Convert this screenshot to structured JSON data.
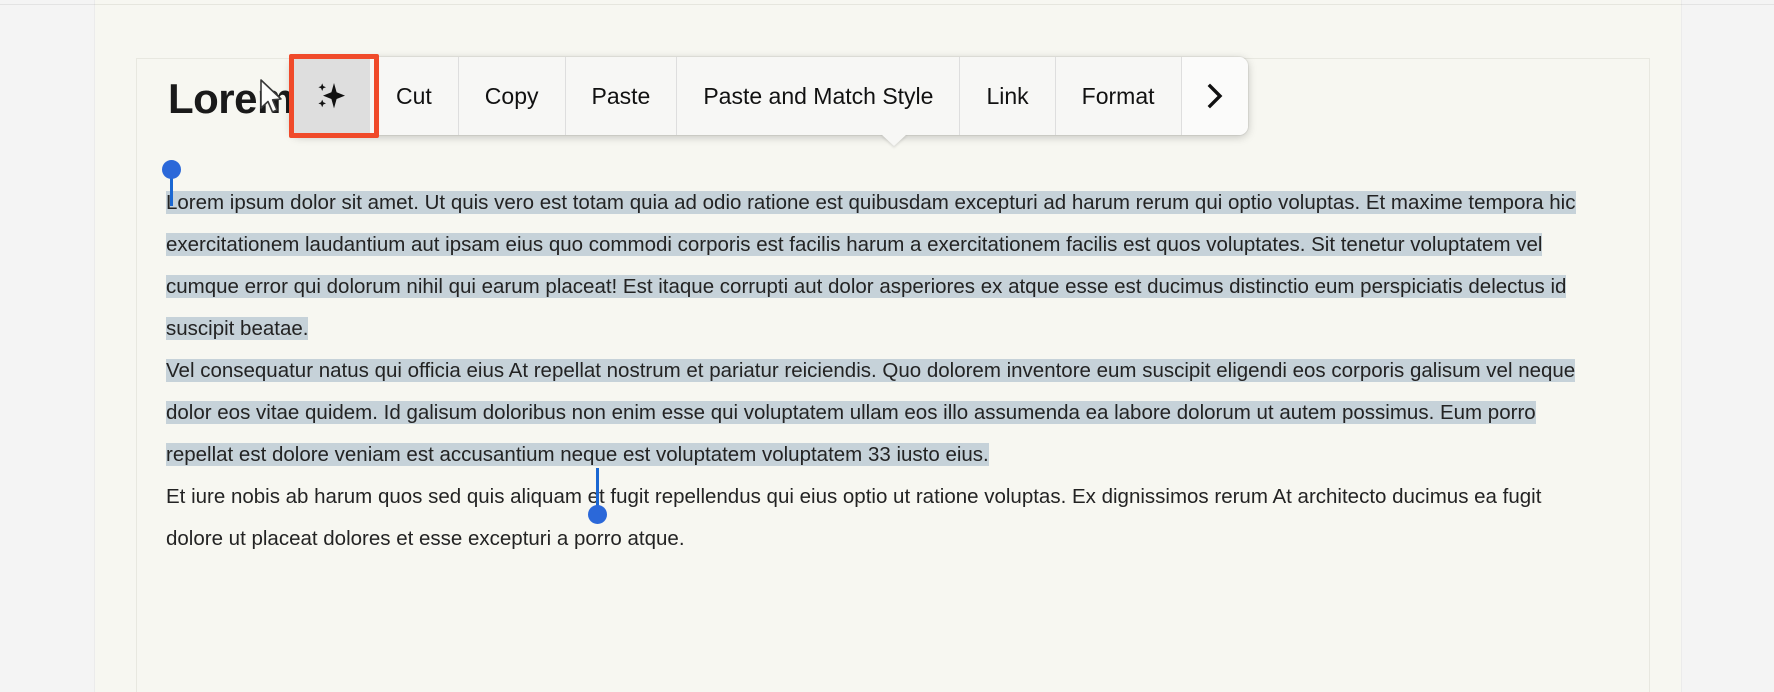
{
  "document": {
    "title": "Lorem",
    "paragraphs": [
      {
        "id": "p1",
        "selected_text": "Lorem ipsum dolor sit amet. Ut quis vero est totam quia ad odio ratione est quibusdam excepturi ad harum rerum qui optio voluptas. Et maxime tempora hic exercitationem laudantium aut ipsam eius quo commodi corporis est facilis harum a exercitationem facilis est quos voluptates. Sit tenetur voluptatem vel cumque error qui dolorum nihil qui earum placeat! Est itaque corrupti aut dolor asperiores ex atque esse est ducimus distinctio eum perspiciatis delectus id suscipit beatae."
      },
      {
        "id": "p2",
        "selected_text": "Vel consequatur natus qui officia eius At repellat nostrum et pariatur reiciendis. Quo dolorem inventore eum suscipit eligendi eos corporis galisum vel neque dolor eos vitae quidem. Id galisum doloribus non enim esse qui voluptatem ullam eos illo assumenda ea labore dolorum ut autem possimus. Eum porro repellat est dolore veniam est accusantium neque est voluptatem voluptatem 33 iusto eius."
      },
      {
        "id": "p3",
        "text": "Et iure nobis ab harum quos sed quis aliquam et fugit repellendus qui eius optio ut ratione voluptas. Ex dignissimos rerum At architecto ducimus ea fugit dolore ut placeat dolores et esse excepturi a porro atque."
      }
    ]
  },
  "context_menu": {
    "items": [
      {
        "id": "sparkle",
        "label": "",
        "icon": "sparkle-icon",
        "highlighted": true
      },
      {
        "id": "cut",
        "label": "Cut",
        "icon": ""
      },
      {
        "id": "copy",
        "label": "Copy",
        "icon": ""
      },
      {
        "id": "paste",
        "label": "Paste",
        "icon": ""
      },
      {
        "id": "paste_match_style",
        "label": "Paste and Match Style",
        "icon": ""
      },
      {
        "id": "link",
        "label": "Link",
        "icon": ""
      },
      {
        "id": "format",
        "label": "Format",
        "icon": ""
      },
      {
        "id": "more",
        "label": "",
        "icon": "chevron-right-icon"
      }
    ]
  },
  "selection": {
    "handle_start": "selection-start-handle",
    "handle_end": "selection-end-handle",
    "highlight_color": "#c6d2d9"
  },
  "colors": {
    "focus_ring": "#f04a2a",
    "handle": "#2b68d9",
    "page_background": "#f7f7f1",
    "app_background": "#f4f4f4",
    "menu_background": "#f7f7f5",
    "menu_active_background": "#dedede"
  }
}
